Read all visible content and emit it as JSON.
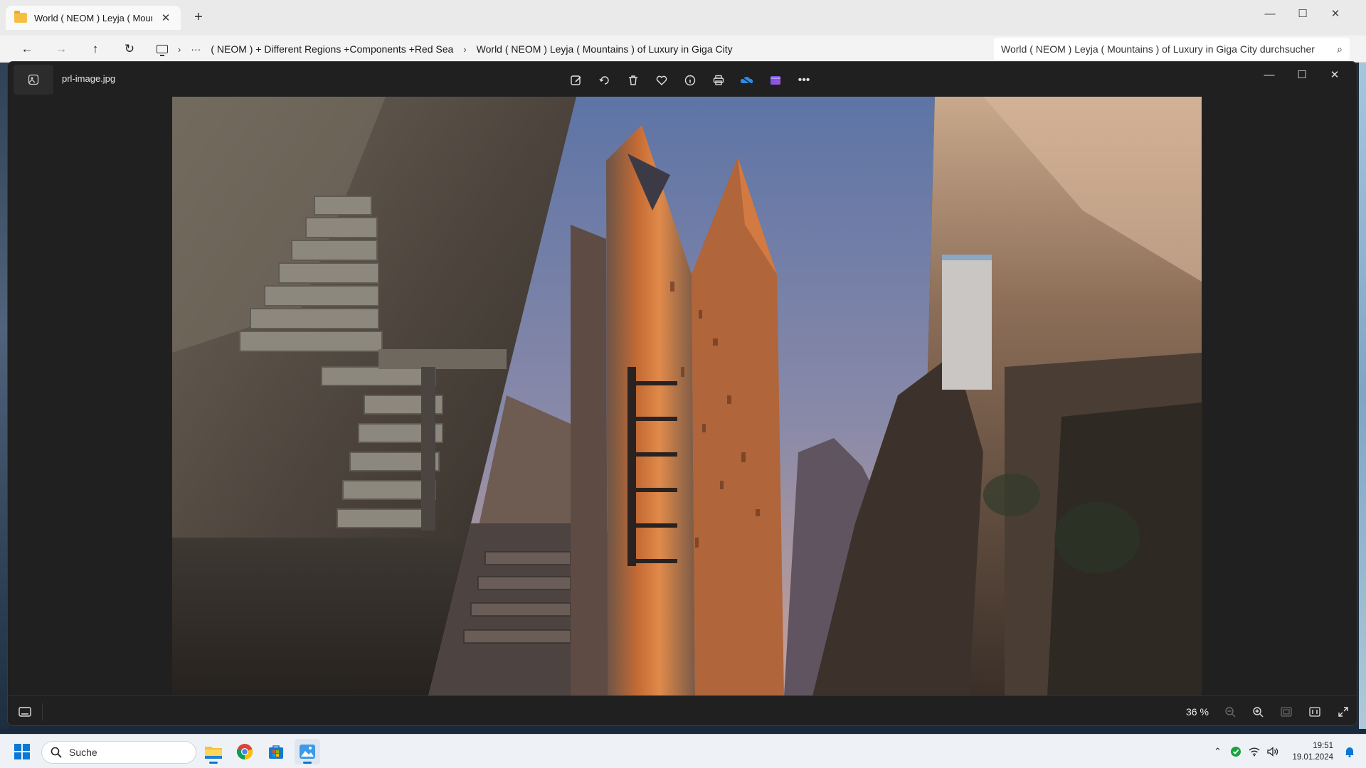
{
  "explorer": {
    "tab_title": "World ( NEOM ) Leyja ( Mount",
    "breadcrumb": [
      "( NEOM ) + Different Regions +Components +Red Sea",
      "World ( NEOM ) Leyja ( Mountains ) of Luxury in Giga City"
    ],
    "search_placeholder": "World ( NEOM ) Leyja ( Mountains ) of Luxury in Giga City durchsucher"
  },
  "viewer": {
    "file_name": "prl-image.jpg",
    "toolbar_icons": [
      "edit-icon",
      "rotate-icon",
      "delete-icon",
      "favorite-icon",
      "info-icon",
      "print-icon",
      "onedrive-icon",
      "clipchamp-icon",
      "more-icon"
    ],
    "zoom": "36 %"
  },
  "taskbar": {
    "search_label": "Suche",
    "time": "19:51",
    "date": "19.01.2024",
    "apps": [
      "file-explorer-icon",
      "chrome-icon",
      "store-icon",
      "photos-icon"
    ]
  },
  "colors": {
    "accent": "#0a78d6",
    "viewer_bg": "#202020",
    "explorer_bg": "#f3f3f3"
  }
}
